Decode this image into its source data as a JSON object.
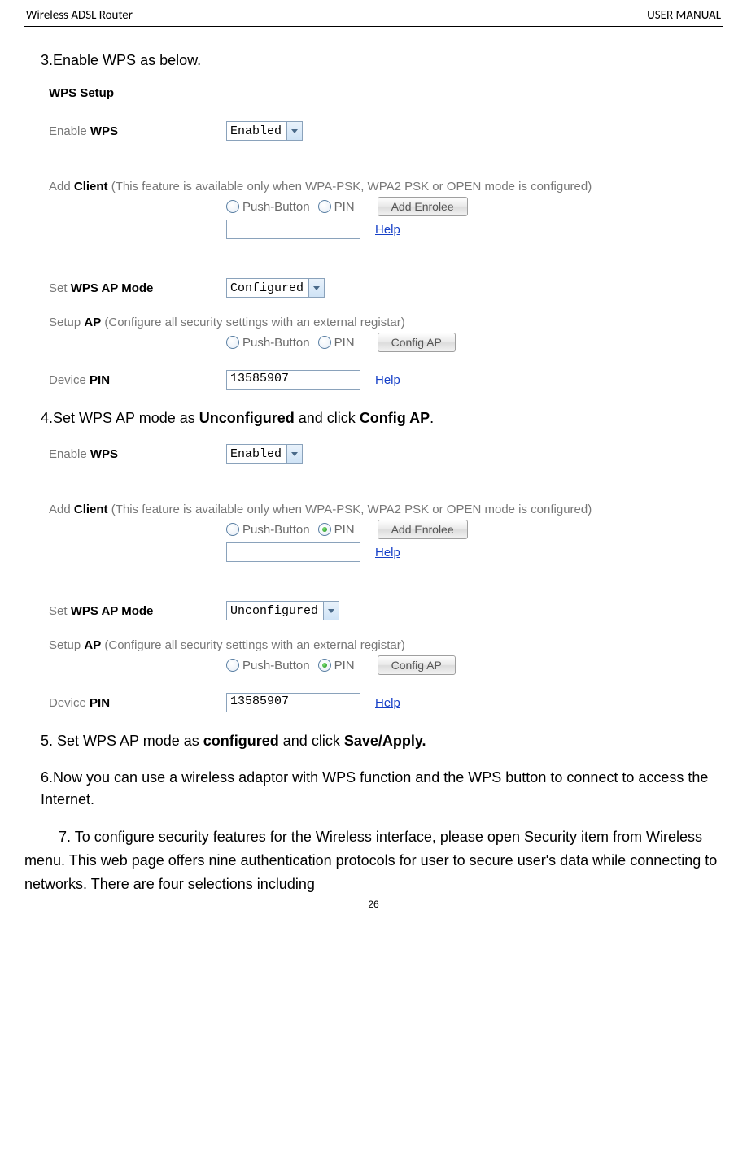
{
  "header": {
    "left": "Wireless ADSL Router",
    "right": "USER MANUAL"
  },
  "steps": {
    "s3": "3.Enable WPS as below.",
    "s4_a": "4.Set WPS AP mode as ",
    "s4_b": "Unconfigured",
    "s4_c": " and click ",
    "s4_d": "Config AP",
    "s4_e": ".",
    "s5_a": "5. Set WPS AP mode as ",
    "s5_b": "configured",
    "s5_c": " and click ",
    "s5_d": "Save/Apply.",
    "s6": "6.Now you can use a wireless adaptor with WPS function and the WPS button to connect   to access the Internet.",
    "s7": "7. To configure security features for the Wireless interface, please open Security item from Wireless menu. This web page offers nine authentication protocols for user to secure user's data while connecting to networks. There are four selections including"
  },
  "fig1": {
    "title": "WPS Setup",
    "enable_label_a": "Enable ",
    "enable_label_b": "WPS",
    "enable_sel": "Enabled",
    "addclient_a": "Add ",
    "addclient_b": "Client",
    "addclient_note": " (This feature is available only when WPA-PSK, WPA2 PSK or OPEN mode is configured)",
    "rb_push": "Push-Button",
    "rb_pin": "PIN",
    "btn_enrolee": "Add Enrolee",
    "help": "Help",
    "setmode_a": "Set ",
    "setmode_b": "WPS AP Mode",
    "setmode_sel": "Configured",
    "setupap_a": "Setup ",
    "setupap_b": "AP",
    "setupap_note": " (Configure all security settings with an external registar)",
    "btn_config": "Config AP",
    "devpin_a": "Device ",
    "devpin_b": "PIN",
    "devpin_val": "13585907"
  },
  "fig2": {
    "enable_label_a": "Enable ",
    "enable_label_b": "WPS",
    "enable_sel": "Enabled",
    "addclient_a": "Add ",
    "addclient_b": "Client",
    "addclient_note": " (This feature is available only when WPA-PSK, WPA2 PSK or OPEN mode is configured)",
    "rb_push": "Push-Button",
    "rb_pin": "PIN",
    "btn_enrolee": "Add Enrolee",
    "help": "Help",
    "setmode_a": "Set ",
    "setmode_b": "WPS AP Mode",
    "setmode_sel": "Unconfigured",
    "setupap_a": "Setup ",
    "setupap_b": "AP",
    "setupap_note": " (Configure all security settings with an external registar)",
    "btn_config": "Config AP",
    "devpin_a": "Device ",
    "devpin_b": "PIN",
    "devpin_val": "13585907"
  },
  "page_num": "26"
}
